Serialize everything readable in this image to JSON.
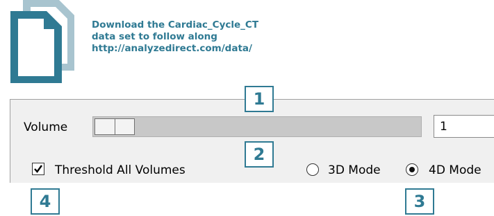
{
  "download_note": {
    "line1": "Download the Cardiac_Cycle_CT",
    "line2": "data set to follow along",
    "line3": "http://analyzedirect.com/data/"
  },
  "icon": {
    "name": "document-stack-icon",
    "color_front": "#2f7a93",
    "color_back": "#a8c4cf"
  },
  "volume_control": {
    "label": "Volume",
    "value": "1",
    "slider_position": 1
  },
  "threshold_checkbox": {
    "label": "Threshold All Volumes",
    "checked": true
  },
  "mode_radio": {
    "options": [
      "3D Mode",
      "4D Mode"
    ],
    "selected": "4D Mode"
  },
  "callouts": {
    "c1": "1",
    "c2": "2",
    "c3": "3",
    "c4": "4"
  },
  "colors": {
    "accent": "#2f7a93",
    "panel_bg": "#f0f0f0",
    "slider_track": "#c8c8c8"
  }
}
